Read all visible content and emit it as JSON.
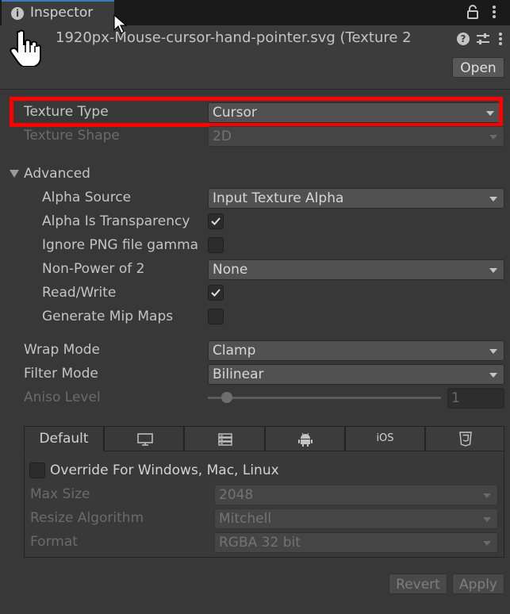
{
  "tab": {
    "title": "Inspector"
  },
  "header": {
    "asset_title": "1920px-Mouse-cursor-hand-pointer.svg (Texture 2",
    "open_label": "Open"
  },
  "fields": {
    "texture_type": {
      "label": "Texture Type",
      "value": "Cursor"
    },
    "texture_shape": {
      "label": "Texture Shape",
      "value": "2D"
    },
    "advanced": {
      "label": "Advanced",
      "expanded": true
    },
    "alpha_source": {
      "label": "Alpha Source",
      "value": "Input Texture Alpha"
    },
    "alpha_is_transparency": {
      "label": "Alpha Is Transparency",
      "checked": true
    },
    "ignore_png_gamma": {
      "label": "Ignore PNG file gamma",
      "checked": false
    },
    "non_power_of_2": {
      "label": "Non-Power of 2",
      "value": "None"
    },
    "read_write": {
      "label": "Read/Write",
      "checked": true
    },
    "generate_mip_maps": {
      "label": "Generate Mip Maps",
      "checked": false
    },
    "wrap_mode": {
      "label": "Wrap Mode",
      "value": "Clamp"
    },
    "filter_mode": {
      "label": "Filter Mode",
      "value": "Bilinear"
    },
    "aniso_level": {
      "label": "Aniso Level",
      "value": "1"
    }
  },
  "platform": {
    "tabs": [
      {
        "label": "Default",
        "icon": "text"
      },
      {
        "label": "",
        "icon": "monitor-icon"
      },
      {
        "label": "",
        "icon": "server-icon"
      },
      {
        "label": "",
        "icon": "android-icon"
      },
      {
        "label": "iOS",
        "icon": "text"
      },
      {
        "label": "",
        "icon": "html5-icon"
      }
    ],
    "override_label": "Override For Windows, Mac, Linux",
    "override_checked": false,
    "max_size": {
      "label": "Max Size",
      "value": "2048"
    },
    "resize_algorithm": {
      "label": "Resize Algorithm",
      "value": "Mitchell"
    },
    "format": {
      "label": "Format",
      "value": "RGBA 32 bit"
    }
  },
  "buttons": {
    "revert": "Revert",
    "apply": "Apply"
  },
  "colors": {
    "highlight": "#ff0000",
    "tab_accent": "#3a79bb",
    "background": "#383838"
  }
}
